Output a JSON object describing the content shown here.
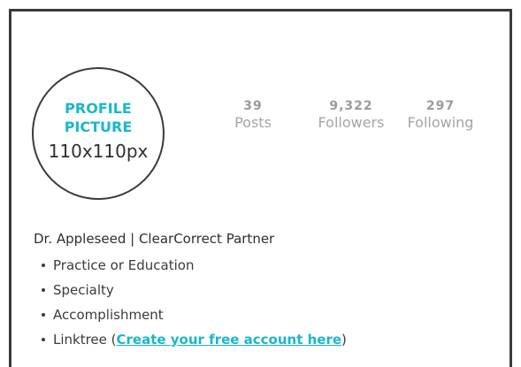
{
  "avatar": {
    "title": "PROFILE PICTURE",
    "size": "110x110px"
  },
  "stats": {
    "posts": {
      "value": "39",
      "label": "Posts"
    },
    "followers": {
      "value": "9,322",
      "label": "Followers"
    },
    "following": {
      "value": "297",
      "label": "Following"
    }
  },
  "bio": {
    "name": "Dr. Appleseed | ClearCorrect Partner",
    "items": [
      "Practice or Education",
      "Specialty",
      "Accomplishment"
    ],
    "linktree": {
      "prefix": "Linktree (",
      "link_text": "Create your free account here",
      "suffix": ")"
    }
  },
  "colors": {
    "accent": "#1ab7c9",
    "border": "#3a3a3a",
    "muted": "#a5a5a5"
  }
}
